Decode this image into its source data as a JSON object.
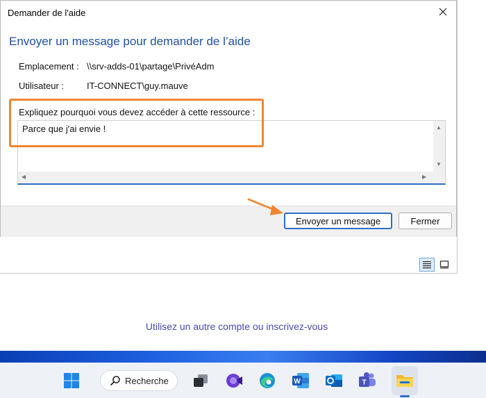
{
  "dialog": {
    "title": "Demander de l'aide",
    "heading": "Envoyer un message pour demander de l’aide",
    "location_label": "Emplacement :",
    "location_value": "\\\\srv-adds-01\\partage\\PrivéAdm",
    "user_label": "Utilisateur :",
    "user_value": "IT-CONNECT\\guy.mauve",
    "explain_label": "Expliquez pourquoi vous devez accéder à cette ressource :",
    "message_value": "Parce que j'ai envie !",
    "send_button": "Envoyer un message",
    "close_button": "Fermer",
    "close_icon": "close-icon",
    "highlight_color": "#f08530"
  },
  "background": {
    "alt_account_link": "Utilisez un autre compte ou inscrivez-vous",
    "view_icons": [
      "details-view-icon",
      "large-icons-view-icon"
    ]
  },
  "taskbar": {
    "search_label": "Recherche",
    "apps": [
      "windows-start-icon",
      "search-icon",
      "task-view-icon",
      "clipchamp-icon",
      "edge-icon",
      "word-icon",
      "outlook-icon",
      "teams-icon",
      "file-explorer-icon"
    ],
    "active_app": "file-explorer-icon"
  },
  "colors": {
    "accent": "#2c6fc8",
    "heading": "#1f4fa0",
    "link": "#4c4ab0",
    "annotation": "#f08530"
  }
}
